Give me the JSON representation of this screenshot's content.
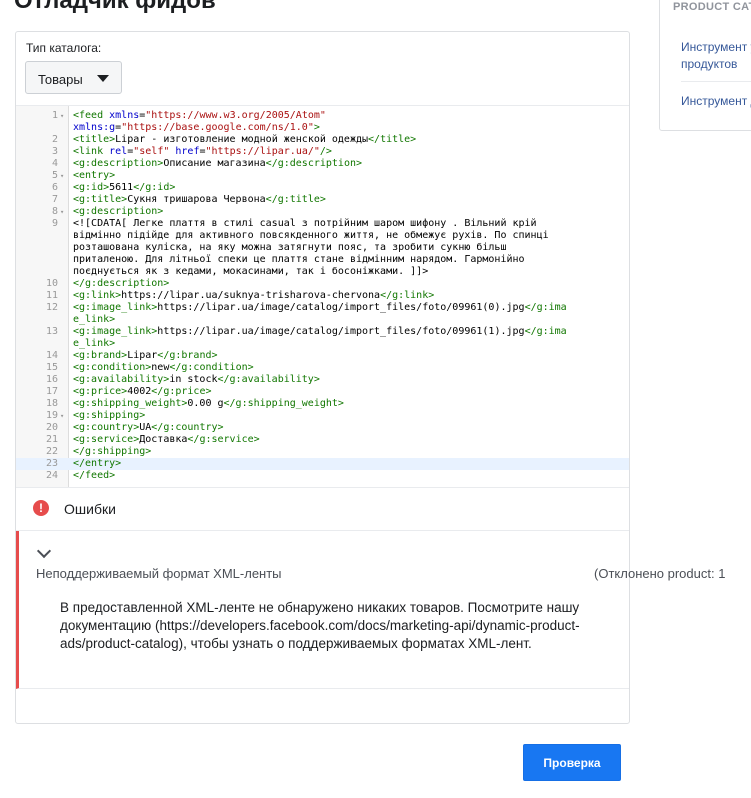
{
  "page": {
    "title": "Отладчик фидов"
  },
  "side_panel": {
    "header": "PRODUCT CAT",
    "links": [
      "Инструмент у продуктов",
      "Инструмент д"
    ]
  },
  "catalog": {
    "label": "Тип каталога:",
    "selected": "Товары"
  },
  "editor": {
    "lines": [
      {
        "n": "1",
        "fold": true,
        "html": "<span class=\"tag\">&lt;feed</span> <span class=\"atn\">xmlns</span>=<span class=\"atv\">\"https://www.w3.org/2005/Atom\"</span>\n<span class=\"atn\">xmlns:g</span>=<span class=\"atv\">\"https://base.google.com/ns/1.0\"</span><span class=\"tag\">&gt;</span>",
        "rows": 2
      },
      {
        "n": "2",
        "fold": false,
        "html": "<span class=\"tag\">&lt;title&gt;</span>Lipar - изготовление модной женской одежды<span class=\"tag\">&lt;/title&gt;</span>",
        "rows": 1
      },
      {
        "n": "3",
        "fold": false,
        "html": "<span class=\"tag\">&lt;link</span> <span class=\"atn\">rel</span>=<span class=\"atv\">\"self\"</span> <span class=\"atn\">href</span>=<span class=\"atv\">\"https://lipar.ua/\"</span><span class=\"tag\">/&gt;</span>",
        "rows": 1
      },
      {
        "n": "4",
        "fold": false,
        "html": "<span class=\"tag\">&lt;g:description&gt;</span>Описание магазина<span class=\"tag\">&lt;/g:description&gt;</span>",
        "rows": 1
      },
      {
        "n": "5",
        "fold": true,
        "html": "<span class=\"tag\">&lt;entry&gt;</span>",
        "rows": 1
      },
      {
        "n": "6",
        "fold": false,
        "html": "<span class=\"tag\">&lt;g:id&gt;</span>5611<span class=\"tag\">&lt;/g:id&gt;</span>",
        "rows": 1
      },
      {
        "n": "7",
        "fold": false,
        "html": "<span class=\"tag\">&lt;g:title&gt;</span>Сукня тришарова Червона<span class=\"tag\">&lt;/g:title&gt;</span>",
        "rows": 1
      },
      {
        "n": "8",
        "fold": true,
        "html": "<span class=\"tag\">&lt;g:description&gt;</span>",
        "rows": 1
      },
      {
        "n": "9",
        "fold": false,
        "html": "&lt;![CDATA[ Легке плаття в стилі casual з потрійним шаром шифону . Вільний крій\nвідмінно підійде для активного повсякденного життя, не обмежує рухів. По спинці\nрозташована куліска, на яку можна затягнути пояс, та зробити сукню більш\nприталеною. Для літньої спеки це плаття стане відмінним нарядом. Гармонійно\nпоєднується як з кедами, мокасинами, так і босоніжками. ]]&gt;",
        "rows": 5
      },
      {
        "n": "10",
        "fold": false,
        "html": "<span class=\"tag\">&lt;/g:description&gt;</span>",
        "rows": 1
      },
      {
        "n": "11",
        "fold": false,
        "html": "<span class=\"tag\">&lt;g:link&gt;</span>https://lipar.ua/suknya-trisharova-chervona<span class=\"tag\">&lt;/g:link&gt;</span>",
        "rows": 1
      },
      {
        "n": "12",
        "fold": false,
        "html": "<span class=\"tag\">&lt;g:image_link&gt;</span>https://lipar.ua/image/catalog/import_files/foto/09961(0).jpg<span class=\"tag\">&lt;/g:ima\ne_link&gt;</span>",
        "rows": 2
      },
      {
        "n": "13",
        "fold": false,
        "html": "<span class=\"tag\">&lt;g:image_link&gt;</span>https://lipar.ua/image/catalog/import_files/foto/09961(1).jpg<span class=\"tag\">&lt;/g:ima\ne_link&gt;</span>",
        "rows": 2
      },
      {
        "n": "14",
        "fold": false,
        "html": "<span class=\"tag\">&lt;g:brand&gt;</span>Lipar<span class=\"tag\">&lt;/g:brand&gt;</span>",
        "rows": 1
      },
      {
        "n": "15",
        "fold": false,
        "html": "<span class=\"tag\">&lt;g:condition&gt;</span>new<span class=\"tag\">&lt;/g:condition&gt;</span>",
        "rows": 1
      },
      {
        "n": "16",
        "fold": false,
        "html": "<span class=\"tag\">&lt;g:availability&gt;</span>in stock<span class=\"tag\">&lt;/g:availability&gt;</span>",
        "rows": 1
      },
      {
        "n": "17",
        "fold": false,
        "html": "<span class=\"tag\">&lt;g:price&gt;</span>4002<span class=\"tag\">&lt;/g:price&gt;</span>",
        "rows": 1
      },
      {
        "n": "18",
        "fold": false,
        "html": "<span class=\"tag\">&lt;g:shipping_weight&gt;</span>0.00 g<span class=\"tag\">&lt;/g:shipping_weight&gt;</span>",
        "rows": 1
      },
      {
        "n": "19",
        "fold": true,
        "html": "<span class=\"tag\">&lt;g:shipping&gt;</span>",
        "rows": 1
      },
      {
        "n": "20",
        "fold": false,
        "html": "<span class=\"tag\">&lt;g:country&gt;</span>UA<span class=\"tag\">&lt;/g:country&gt;</span>",
        "rows": 1
      },
      {
        "n": "21",
        "fold": false,
        "html": "<span class=\"tag\">&lt;g:service&gt;</span>Доставка<span class=\"tag\">&lt;/g:service&gt;</span>",
        "rows": 1
      },
      {
        "n": "22",
        "fold": false,
        "html": "<span class=\"tag\">&lt;/g:shipping&gt;</span>",
        "rows": 1
      },
      {
        "n": "23",
        "fold": false,
        "html": "<span class=\"tag\">&lt;/entry&gt;</span>",
        "rows": 1,
        "active": true
      },
      {
        "n": "24",
        "fold": false,
        "html": "<span class=\"tag\">&lt;/feed&gt;</span>",
        "rows": 1
      }
    ]
  },
  "errors": {
    "title": "Ошибки",
    "items": [
      {
        "title": "Неподдерживаемый формат XML-ленты",
        "count": "(Отклонено product: 1",
        "description": "В предоставленной XML-ленте не обнаружено никаких товаров. Посмотрите нашу документацию (https://developers.facebook.com/docs/marketing-api/dynamic-product-ads/product-catalog), чтобы узнать о поддерживаемых форматах XML-лент."
      }
    ]
  },
  "actions": {
    "check_label": "Проверка"
  },
  "colors": {
    "accent": "#1877f2",
    "error": "#e64c4c"
  }
}
